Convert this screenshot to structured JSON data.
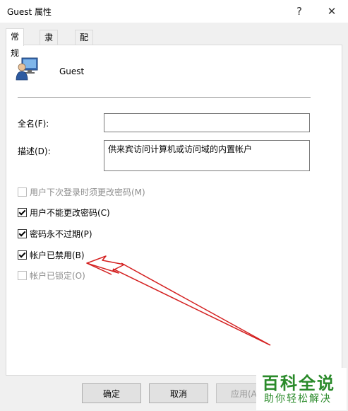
{
  "window": {
    "title": "Guest 属性",
    "help_label": "?",
    "close_label": "✕"
  },
  "tabs": [
    {
      "label": "常规",
      "active": true
    },
    {
      "label": "隶属于",
      "active": false
    },
    {
      "label": "配置文件",
      "active": false
    }
  ],
  "user": {
    "icon": "user-icon",
    "name": "Guest"
  },
  "form": {
    "fullname_label": "全名(F):",
    "fullname_value": "",
    "description_label": "描述(D):",
    "description_value": "供来宾访问计算机或访问域的内置帐户"
  },
  "checkboxes": [
    {
      "label": "用户下次登录时须更改密码(M)",
      "checked": false,
      "enabled": false
    },
    {
      "label": "用户不能更改密码(C)",
      "checked": true,
      "enabled": true
    },
    {
      "label": "密码永不过期(P)",
      "checked": true,
      "enabled": true
    },
    {
      "label": "帐户已禁用(B)",
      "checked": true,
      "enabled": true
    },
    {
      "label": "帐户已锁定(O)",
      "checked": false,
      "enabled": false
    }
  ],
  "buttons": {
    "ok": "确定",
    "cancel": "取消",
    "apply": "应用(A"
  },
  "annotation": {
    "arrow_color": "#d42020"
  },
  "watermark": {
    "title": "百科全说",
    "subtitle": "助你轻松解决"
  }
}
